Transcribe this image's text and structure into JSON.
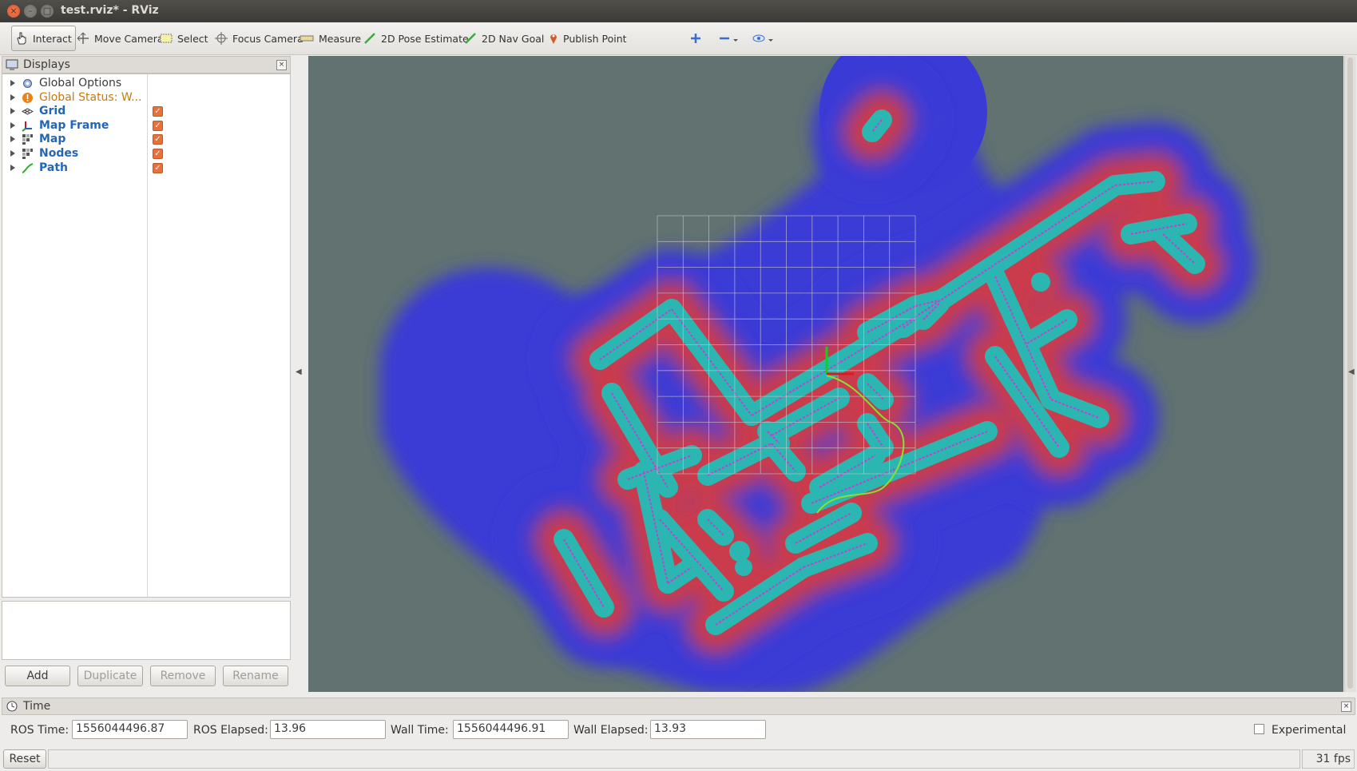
{
  "window": {
    "title": "test.rviz* - RViz",
    "close": "×",
    "minimize": "–",
    "maximize": "□"
  },
  "toolbar": {
    "tools": [
      {
        "label": "Interact",
        "icon": "hand-pointer-icon",
        "active": true
      },
      {
        "label": "Move Camera",
        "icon": "move-camera-icon"
      },
      {
        "label": "Select",
        "icon": "select-box-icon"
      },
      {
        "label": "Focus Camera",
        "icon": "focus-crosshair-icon"
      },
      {
        "label": "Measure",
        "icon": "ruler-icon"
      },
      {
        "label": "2D Pose Estimate",
        "icon": "green-arrow-icon"
      },
      {
        "label": "2D Nav Goal",
        "icon": "green-arrow-icon"
      },
      {
        "label": "Publish Point",
        "icon": "map-pin-icon"
      }
    ]
  },
  "displays": {
    "title": "Displays",
    "close": "×",
    "items": [
      {
        "label": "Global Options",
        "style": "normal",
        "checked": null,
        "icon": "gear-icon"
      },
      {
        "label": "Global Status: W...",
        "style": "warn",
        "checked": null,
        "icon": "warning-icon"
      },
      {
        "label": "Grid",
        "style": "bold",
        "checked": true,
        "icon": "grid-icon"
      },
      {
        "label": "Map Frame",
        "style": "bold",
        "checked": true,
        "icon": "axes-icon"
      },
      {
        "label": "Map",
        "style": "bold",
        "checked": true,
        "icon": "map-icon"
      },
      {
        "label": "Nodes",
        "style": "bold",
        "checked": true,
        "icon": "map-icon"
      },
      {
        "label": "Path",
        "style": "bold",
        "checked": true,
        "icon": "path-icon"
      }
    ],
    "buttons": {
      "add": "Add",
      "duplicate": "Duplicate",
      "remove": "Remove",
      "rename": "Rename"
    }
  },
  "colors": {
    "background": "#617270",
    "obstacle": "#2bb6b2",
    "inflation_outer": "#3a3ad6",
    "inflation_inner": "#d83a3a",
    "path": "#88e030",
    "walls": "#c040d0"
  },
  "time": {
    "title": "Time",
    "close": "×",
    "ros_time_label": "ROS Time:",
    "ros_time": "1556044496.87",
    "ros_elapsed_label": "ROS Elapsed:",
    "ros_elapsed": "13.96",
    "wall_time_label": "Wall Time:",
    "wall_time": "1556044496.91",
    "wall_elapsed_label": "Wall Elapsed:",
    "wall_elapsed": "13.93",
    "experimental": "Experimental"
  },
  "status": {
    "reset": "Reset",
    "fps": "31 fps"
  }
}
